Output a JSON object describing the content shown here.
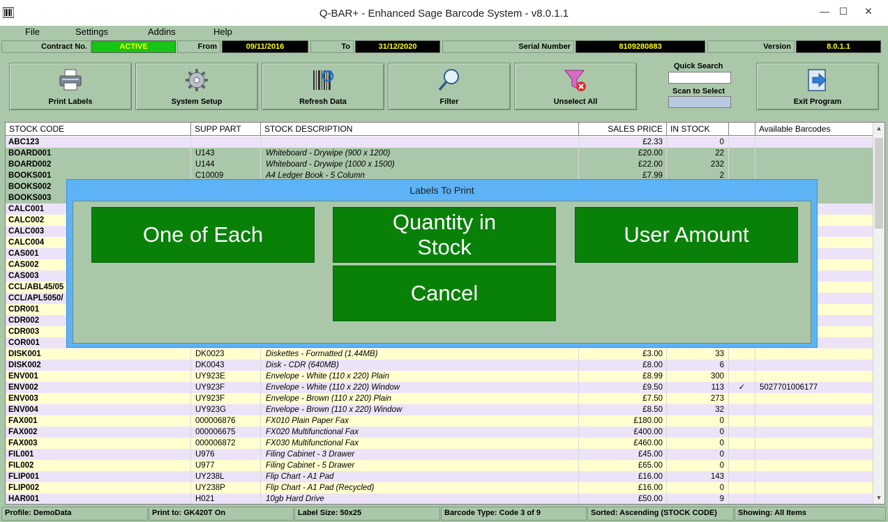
{
  "window": {
    "title": "Q-BAR+ - Enhanced Sage Barcode System - v8.0.1.1",
    "minimize_glyph": "—",
    "maximize_glyph": "☐",
    "close_glyph": "✕"
  },
  "menu": [
    "File",
    "Settings",
    "Addins",
    "Help"
  ],
  "info": {
    "contract_label": "Contract No.",
    "contract_value": "ACTIVE",
    "from_label": "From",
    "from_value": "09/11/2016",
    "to_label": "To",
    "to_value": "31/12/2020",
    "serial_label": "Serial Number",
    "serial_value": "8109280883",
    "version_label": "Version",
    "version_value": "8.0.1.1"
  },
  "toolbar": {
    "print_labels": "Print Labels",
    "system_setup": "System Setup",
    "refresh_data": "Refresh Data",
    "filter": "Filter",
    "unselect_all": "Unselect All",
    "quick_search_label": "Quick Search",
    "scan_to_select_label": "Scan to Select",
    "exit_program": "Exit Program"
  },
  "grid": {
    "columns": [
      "STOCK CODE",
      "SUPP PART",
      "STOCK DESCRIPTION",
      "SALES PRICE",
      "IN STOCK",
      "",
      "Available Barcodes"
    ],
    "rows": [
      {
        "code": "ABC123",
        "supp": "",
        "desc": "",
        "price": "£2.33",
        "stock": "0",
        "tick": "",
        "barcode": "",
        "style": "a"
      },
      {
        "code": "BOARD001",
        "supp": "U143",
        "desc": "Whiteboard - Drywipe (900 x 1200)",
        "price": "£20.00",
        "stock": "22",
        "tick": "",
        "barcode": "",
        "style": "sel"
      },
      {
        "code": "BOARD002",
        "supp": "U144",
        "desc": "Whiteboard - Drywipe (1000 x 1500)",
        "price": "£22.00",
        "stock": "232",
        "tick": "",
        "barcode": "",
        "style": "sel"
      },
      {
        "code": "BOOKS001",
        "supp": "C10009",
        "desc": "A4 Ledger Book - 5 Column",
        "price": "£7.99",
        "stock": "2",
        "tick": "",
        "barcode": "",
        "style": "sel"
      },
      {
        "code": "BOOKS002",
        "supp": "",
        "desc": "",
        "price": "",
        "stock": "",
        "tick": "",
        "barcode": "",
        "style": "sel"
      },
      {
        "code": "BOOKS003",
        "supp": "",
        "desc": "",
        "price": "",
        "stock": "",
        "tick": "",
        "barcode": "",
        "style": "sel"
      },
      {
        "code": "CALC001",
        "supp": "",
        "desc": "",
        "price": "",
        "stock": "",
        "tick": "",
        "barcode": "",
        "style": "a"
      },
      {
        "code": "CALC002",
        "supp": "",
        "desc": "",
        "price": "",
        "stock": "",
        "tick": "",
        "barcode": "",
        "style": "b"
      },
      {
        "code": "CALC003",
        "supp": "",
        "desc": "",
        "price": "",
        "stock": "",
        "tick": "",
        "barcode": "",
        "style": "a"
      },
      {
        "code": "CALC004",
        "supp": "",
        "desc": "",
        "price": "",
        "stock": "",
        "tick": "",
        "barcode": "",
        "style": "b"
      },
      {
        "code": "CAS001",
        "supp": "",
        "desc": "",
        "price": "",
        "stock": "",
        "tick": "",
        "barcode": "",
        "style": "a"
      },
      {
        "code": "CAS002",
        "supp": "",
        "desc": "",
        "price": "",
        "stock": "",
        "tick": "",
        "barcode": "",
        "style": "b"
      },
      {
        "code": "CAS003",
        "supp": "",
        "desc": "",
        "price": "",
        "stock": "",
        "tick": "",
        "barcode": "",
        "style": "a"
      },
      {
        "code": "CCL/ABL45/05",
        "supp": "",
        "desc": "",
        "price": "",
        "stock": "",
        "tick": "",
        "barcode": "",
        "style": "b"
      },
      {
        "code": "CCL/APL5050/",
        "supp": "",
        "desc": "",
        "price": "",
        "stock": "",
        "tick": "",
        "barcode": "",
        "style": "a"
      },
      {
        "code": "CDR001",
        "supp": "",
        "desc": "",
        "price": "",
        "stock": "",
        "tick": "",
        "barcode": "",
        "style": "b"
      },
      {
        "code": "CDR002",
        "supp": "",
        "desc": "",
        "price": "",
        "stock": "",
        "tick": "",
        "barcode": "",
        "style": "a"
      },
      {
        "code": "CDR003",
        "supp": "",
        "desc": "",
        "price": "",
        "stock": "",
        "tick": "",
        "barcode": "",
        "style": "b"
      },
      {
        "code": "COR001",
        "supp": "",
        "desc": "",
        "price": "",
        "stock": "",
        "tick": "",
        "barcode": "",
        "style": "a"
      },
      {
        "code": "DISK001",
        "supp": "DK0023",
        "desc": "Diskettes - Formatted (1.44MB)",
        "price": "£3.00",
        "stock": "33",
        "tick": "",
        "barcode": "",
        "style": "b"
      },
      {
        "code": "DISK002",
        "supp": "DK0043",
        "desc": "Disk - CDR (640MB)",
        "price": "£8.00",
        "stock": "6",
        "tick": "",
        "barcode": "",
        "style": "a"
      },
      {
        "code": "ENV001",
        "supp": "UY923E",
        "desc": "Envelope - White (110 x 220) Plain",
        "price": "£8.99",
        "stock": "300",
        "tick": "",
        "barcode": "",
        "style": "b"
      },
      {
        "code": "ENV002",
        "supp": "UY923F",
        "desc": "Envelope - White (110 x 220) Window",
        "price": "£9.50",
        "stock": "113",
        "tick": "✓",
        "barcode": "5027701006177",
        "style": "a"
      },
      {
        "code": "ENV003",
        "supp": "UY923F",
        "desc": "Envelope - Brown (110 x 220) Plain",
        "price": "£7.50",
        "stock": "273",
        "tick": "",
        "barcode": "",
        "style": "b"
      },
      {
        "code": "ENV004",
        "supp": "UY923G",
        "desc": "Envelope - Brown (110 x 220) Window",
        "price": "£8.50",
        "stock": "32",
        "tick": "",
        "barcode": "",
        "style": "a"
      },
      {
        "code": "FAX001",
        "supp": "000006876",
        "desc": "FX010 Plain Paper Fax",
        "price": "£180.00",
        "stock": "0",
        "tick": "",
        "barcode": "",
        "style": "b"
      },
      {
        "code": "FAX002",
        "supp": "000006675",
        "desc": "FX020 Multifunctional Fax",
        "price": "£400.00",
        "stock": "0",
        "tick": "",
        "barcode": "",
        "style": "a"
      },
      {
        "code": "FAX003",
        "supp": "000006872",
        "desc": "FX030 Multifunctional Fax",
        "price": "£460.00",
        "stock": "0",
        "tick": "",
        "barcode": "",
        "style": "b"
      },
      {
        "code": "FIL001",
        "supp": "U976",
        "desc": "Filing Cabinet - 3 Drawer",
        "price": "£45.00",
        "stock": "0",
        "tick": "",
        "barcode": "",
        "style": "a"
      },
      {
        "code": "FIL002",
        "supp": "U977",
        "desc": "Filing Cabinet - 5 Drawer",
        "price": "£65.00",
        "stock": "0",
        "tick": "",
        "barcode": "",
        "style": "b"
      },
      {
        "code": "FLIP001",
        "supp": "UY238L",
        "desc": "Flip Chart - A1 Pad",
        "price": "£16.00",
        "stock": "143",
        "tick": "",
        "barcode": "",
        "style": "a"
      },
      {
        "code": "FLIP002",
        "supp": "UY238P",
        "desc": "Flip Chart - A1 Pad (Recycled)",
        "price": "£16.00",
        "stock": "0",
        "tick": "",
        "barcode": "",
        "style": "b"
      },
      {
        "code": "HAR001",
        "supp": "H021",
        "desc": "10gb Hard Drive",
        "price": "£50.00",
        "stock": "9",
        "tick": "",
        "barcode": "",
        "style": "a"
      }
    ]
  },
  "status": {
    "profile": "Profile: DemoData",
    "print_to": "Print to: GK420T On",
    "label_size": "Label Size: 50x25",
    "barcode_type": "Barcode Type: Code 3 of 9",
    "sorted": "Sorted: Ascending (STOCK CODE)",
    "showing": "Showing: All Items"
  },
  "dialog": {
    "title": "Labels To Print",
    "one_of_each": "One of Each",
    "quantity_in_stock": "Quantity in Stock",
    "user_amount": "User Amount",
    "cancel": "Cancel"
  },
  "colors": {
    "panel": "#aac7aa",
    "active_green": "#16c416",
    "dialog_blue": "#5db3f6",
    "dialog_button": "#098109",
    "row_alt_a": "#ede3f8",
    "row_alt_b": "#ffffcf"
  },
  "icons": [
    "printer-icon",
    "gear-icon",
    "barcode-refresh-icon",
    "magnifier-icon",
    "funnel-clear-icon",
    "exit-door-icon",
    "app-barcode-icon"
  ]
}
